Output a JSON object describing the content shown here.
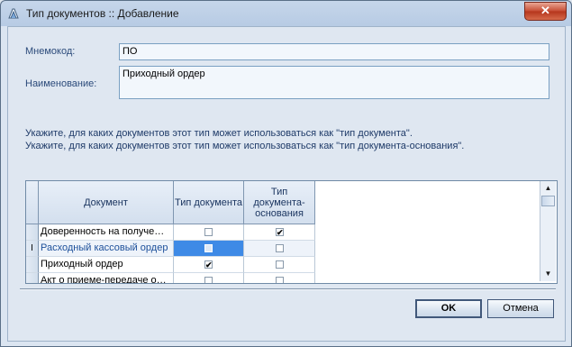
{
  "window": {
    "title": "Тип документов :: Добавление",
    "close_symbol": "✕"
  },
  "form": {
    "mnemocode": {
      "label": "Мнемокод:",
      "value": "ПО"
    },
    "name": {
      "label": "Наименование:",
      "value": "Приходный ордер"
    }
  },
  "hints": [
    "Укажите, для каких документов этот тип может использоваться как \"тип документа\".",
    "Укажите, для каких документов этот тип может использоваться как \"тип документа-основания\"."
  ],
  "grid": {
    "columns": [
      "Документ",
      "Тип документа",
      "Тип документа-основания"
    ],
    "rows": [
      {
        "document": "Доверенность на получе…",
        "doc_type": false,
        "base_type": true
      },
      {
        "document": "Расходный кассовый ордер",
        "doc_type": false,
        "base_type": false,
        "selected": true
      },
      {
        "document": "Приходный ордер",
        "doc_type": true,
        "base_type": false
      },
      {
        "document": "Акт о приеме-передаче о…",
        "doc_type": false,
        "base_type": false
      }
    ],
    "current_row_marker": "I"
  },
  "buttons": {
    "ok": "OK",
    "cancel": "Отмена"
  },
  "check_glyph": "✔",
  "colors": {
    "selection": "#3e8ae6",
    "label": "#2b4a7a",
    "hint": "#1e3a68"
  }
}
